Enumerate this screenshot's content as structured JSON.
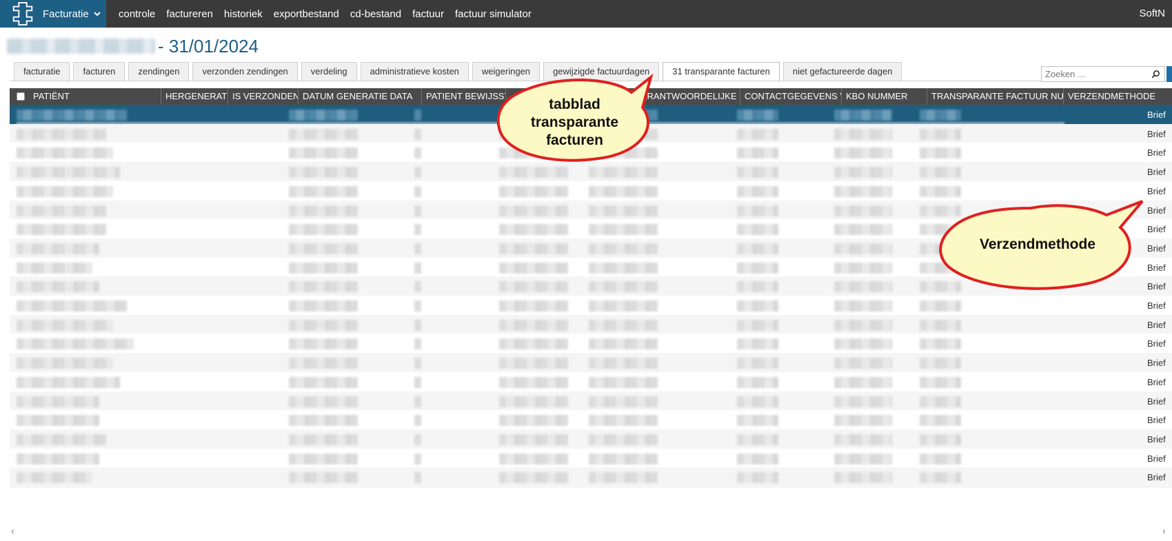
{
  "nav": {
    "module": "Facturatie",
    "items": [
      "controle",
      "factureren",
      "historiek",
      "exportbestand",
      "cd-bestand",
      "factuur",
      "factuur simulator"
    ],
    "user": "SoftN"
  },
  "page": {
    "title": "- 31/01/2024"
  },
  "tabs": [
    {
      "label": "facturatie",
      "active": false
    },
    {
      "label": "facturen",
      "active": false
    },
    {
      "label": "zendingen",
      "active": false
    },
    {
      "label": "verzonden zendingen",
      "active": false
    },
    {
      "label": "verdeling",
      "active": false
    },
    {
      "label": "administratieve kosten",
      "active": false
    },
    {
      "label": "weigeringen",
      "active": false
    },
    {
      "label": "gewijzigde factuurdagen",
      "active": false
    },
    {
      "label": "31 transparante facturen",
      "active": true
    },
    {
      "label": "niet gefactureerde dagen",
      "active": false
    }
  ],
  "search": {
    "placeholder": "Zoeken ..."
  },
  "grid": {
    "columns": [
      "PATIËNT",
      "HERGENERATIE NODIG",
      "IS VERZONDEN ONLINE",
      "DATUM GENERATIE DATA",
      "PATIENT BEWIJSSTUK",
      "NAAM VERANTWOORDELIJKE",
      "CONTACTGEGEVENS VERANTWOORDELIJKE",
      "KBO NUMMER",
      "TRANSPARANTE FACTUUR NUMMER",
      "VERZENDMETHODE"
    ],
    "rows": [
      "Brief",
      "Brief",
      "Brief",
      "Brief",
      "Brief",
      "Brief",
      "Brief",
      "Brief",
      "Brief",
      "Brief",
      "Brief",
      "Brief",
      "Brief",
      "Brief",
      "Brief",
      "Brief",
      "Brief",
      "Brief",
      "Brief",
      "Brief"
    ]
  },
  "callouts": {
    "tabblad": "tabblad transparante facturen",
    "verzendmethode": "Verzendmethode"
  },
  "colors": {
    "brand": "#1e5f86",
    "navbar": "#3a3a3a",
    "header": "#4a4a4a",
    "callout_fill": "#fdf9c4",
    "callout_border": "#e02020"
  }
}
